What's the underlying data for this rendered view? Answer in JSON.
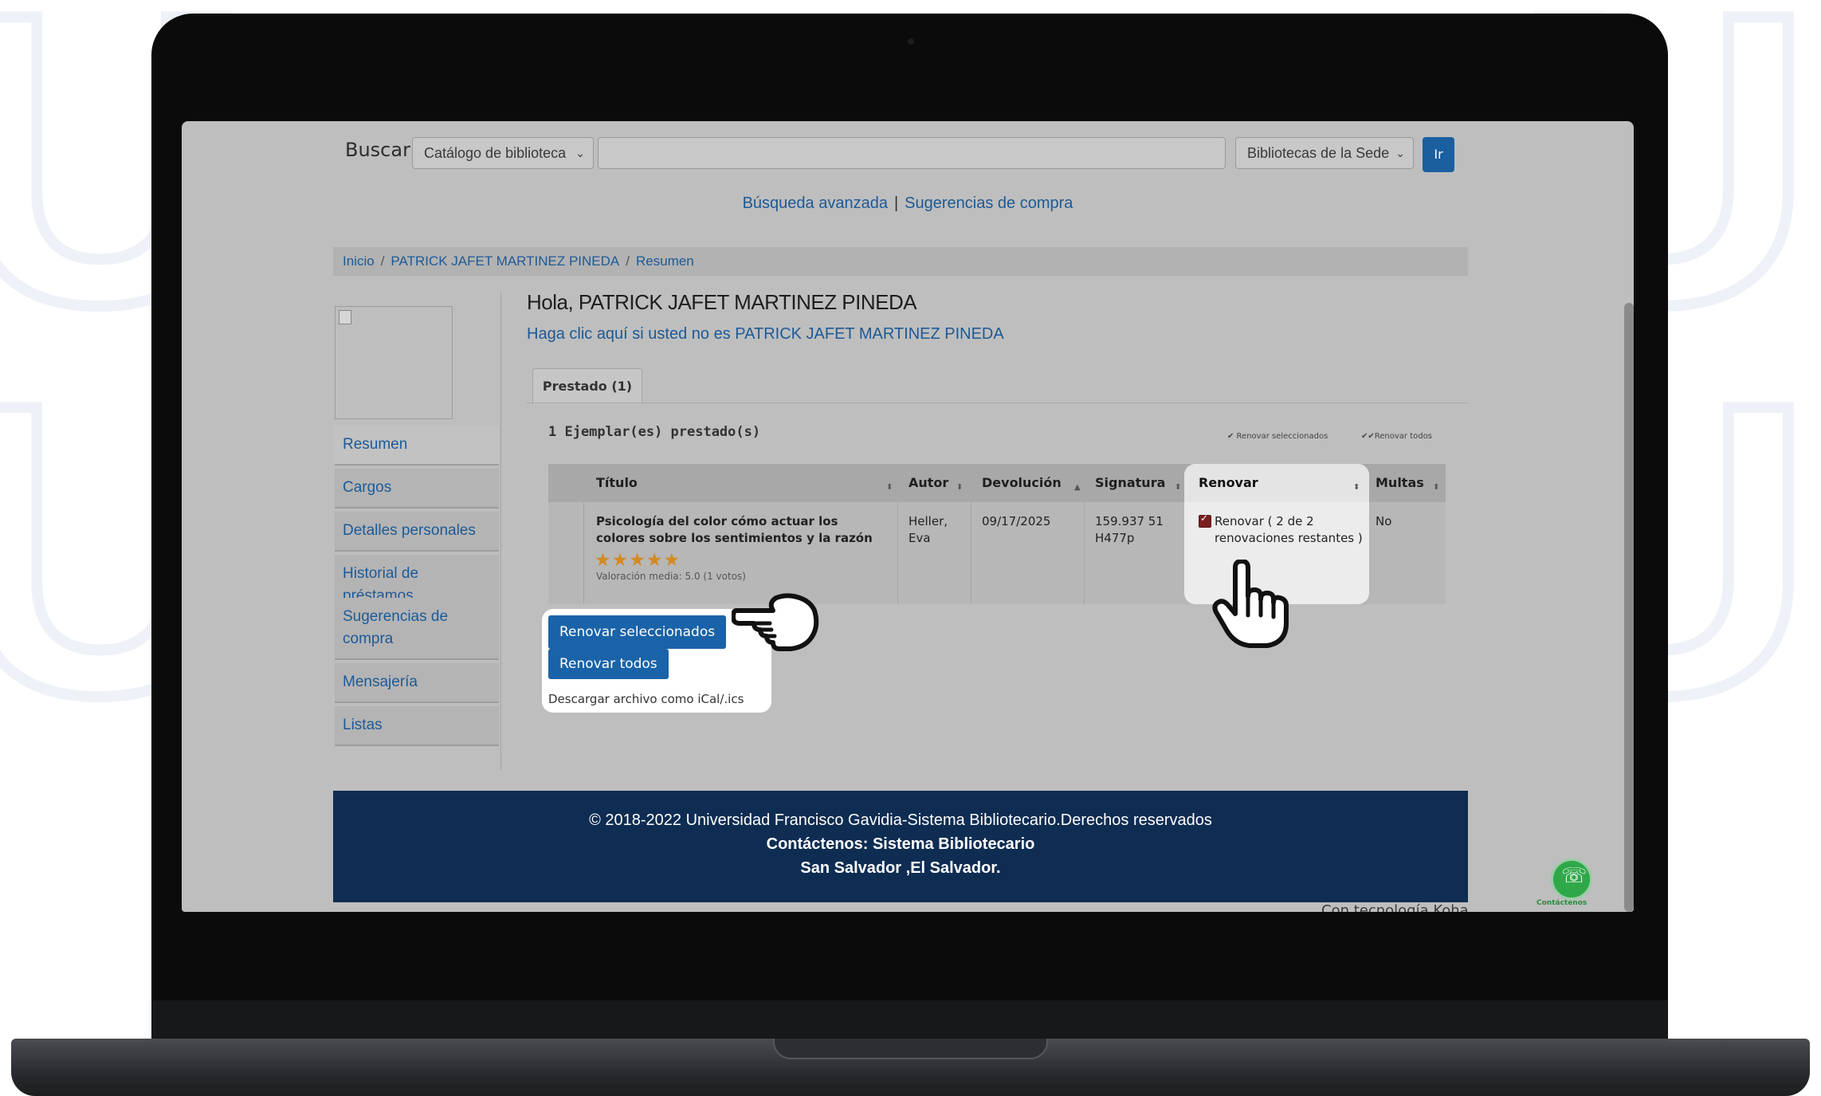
{
  "search": {
    "label": "Buscar",
    "catalog_select": "Catálogo de biblioteca",
    "query_value": "",
    "library_select": "Bibliotecas de la Sede",
    "go_label": "Ir"
  },
  "top_links": {
    "advanced": "Búsqueda avanzada",
    "separator": "|",
    "suggestions": "Sugerencias de compra"
  },
  "breadcrumb": {
    "home": "Inicio",
    "sep": "/",
    "user": "PATRICK JAFET MARTINEZ PINEDA",
    "current": "Resumen"
  },
  "sidebar": {
    "items": [
      {
        "label": "Resumen"
      },
      {
        "label": "Cargos"
      },
      {
        "label": "Detalles personales"
      },
      {
        "label": "Historial de préstamos"
      },
      {
        "label": "Sugerencias de compra"
      },
      {
        "label": "Mensajería"
      },
      {
        "label": "Listas"
      }
    ]
  },
  "main": {
    "greeting": "Hola, PATRICK JAFET MARTINEZ PINEDA",
    "not_you": "Haga clic aquí si usted no es PATRICK JAFET MARTINEZ PINEDA",
    "tab_label": "Prestado (1)",
    "count_label": "1 Ejemplar(es) prestado(s)",
    "renew_selected_small": "✔ Renovar seleccionados",
    "renew_all_small": "✔✔Renovar todos"
  },
  "table": {
    "headers": {
      "title": "Título",
      "author": "Autor",
      "due": "Devolución",
      "call_number": "Signatura",
      "renew": "Renovar",
      "fines": "Multas"
    },
    "rows": [
      {
        "title": "Psicología del color cómo actuar los colores sobre los sentimientos y la razón",
        "stars": "★★★★★",
        "rating": "Valoración media: 5.0 (1 votos)",
        "author": "Heller, Eva",
        "due": "09/17/2025",
        "call_number": "159.937 51 H477p",
        "renew": "Renovar ( 2 de 2 renovaciones restantes )",
        "fines": "No"
      }
    ]
  },
  "actions": {
    "renew_selected": "Renovar seleccionados",
    "renew_all": "Renovar todos",
    "ical": "Descargar archivo como iCal/.ics"
  },
  "footer": {
    "line1": "© 2018-2022 Universidad Francisco Gavidia-Sistema Bibliotecario.Derechos reservados",
    "line2": "Contáctenos: Sistema Bibliotecario",
    "line3": "San Salvador ,El Salvador.",
    "tech": "Con tecnología Koha"
  },
  "whatsapp": {
    "label": "Contáctenos"
  },
  "colors": {
    "link": "#1d5a96",
    "button": "#1b63a8",
    "footer_bg": "#0f2d52",
    "star": "#d28a22"
  }
}
